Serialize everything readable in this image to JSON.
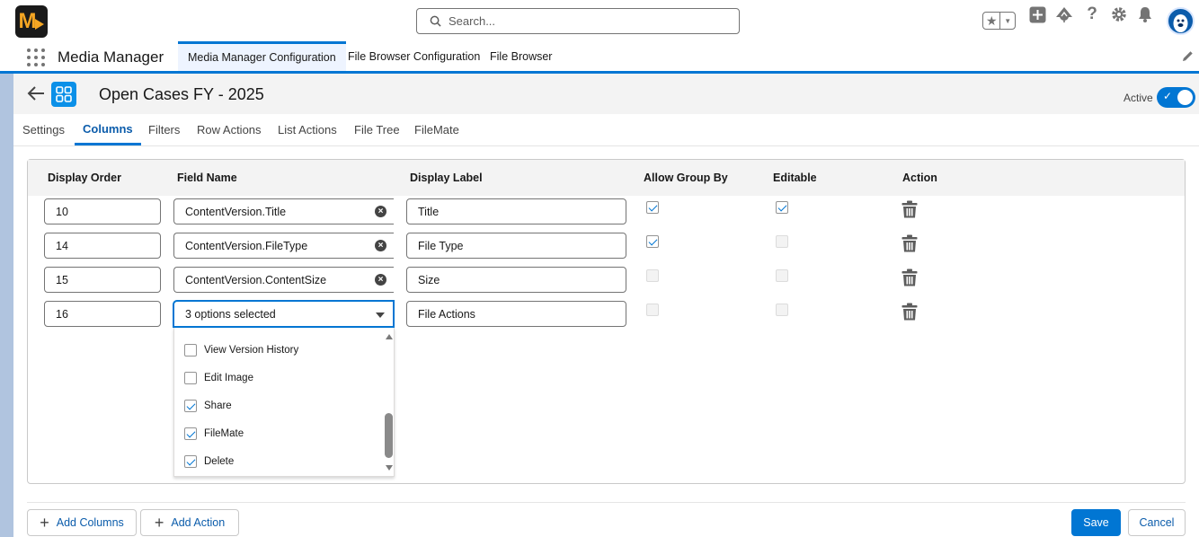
{
  "header": {
    "logo_text": "M",
    "search_placeholder": "Search..."
  },
  "app_nav": {
    "app_name": "Media Manager",
    "tabs": [
      {
        "label": "Media Manager Configuration",
        "active": true
      },
      {
        "label": "File Browser Configuration",
        "active": false
      },
      {
        "label": "File Browser",
        "active": false
      }
    ]
  },
  "record": {
    "title": "Open Cases FY - 2025",
    "active_label": "Active",
    "active": true
  },
  "tabs": [
    "Settings",
    "Columns",
    "Filters",
    "Row Actions",
    "List Actions",
    "File Tree",
    "FileMate"
  ],
  "active_tab": "Columns",
  "columns_table": {
    "headers": [
      "Display Order",
      "Field Name",
      "Display Label",
      "Allow Group By",
      "Editable",
      "Action"
    ],
    "rows": [
      {
        "order": "10",
        "field": "ContentVersion.Title",
        "label": "Title",
        "group_by": true,
        "group_by_enabled": true,
        "editable": true,
        "editable_enabled": true
      },
      {
        "order": "14",
        "field": "ContentVersion.FileType",
        "label": "File Type",
        "group_by": true,
        "group_by_enabled": true,
        "editable": false,
        "editable_enabled": false
      },
      {
        "order": "15",
        "field": "ContentVersion.ContentSize",
        "label": "Size",
        "group_by": false,
        "group_by_enabled": false,
        "editable": false,
        "editable_enabled": false
      },
      {
        "order": "16",
        "field": "3 options selected",
        "label": "File Actions",
        "group_by": false,
        "group_by_enabled": false,
        "editable": false,
        "editable_enabled": false
      }
    ]
  },
  "dropdown": {
    "options": [
      {
        "label": "View Version History",
        "checked": false
      },
      {
        "label": "Edit Image",
        "checked": false
      },
      {
        "label": "Share",
        "checked": true
      },
      {
        "label": "FileMate",
        "checked": true
      },
      {
        "label": "Delete",
        "checked": true
      }
    ]
  },
  "footer": {
    "add_columns": "Add Columns",
    "add_action": "Add Action",
    "save": "Save",
    "cancel": "Cancel"
  },
  "colors": {
    "brand": "#0176d3",
    "logo_bg": "#1a1a1a",
    "logo_accent": "#f5a623",
    "object_icon": "#0b90e8"
  }
}
